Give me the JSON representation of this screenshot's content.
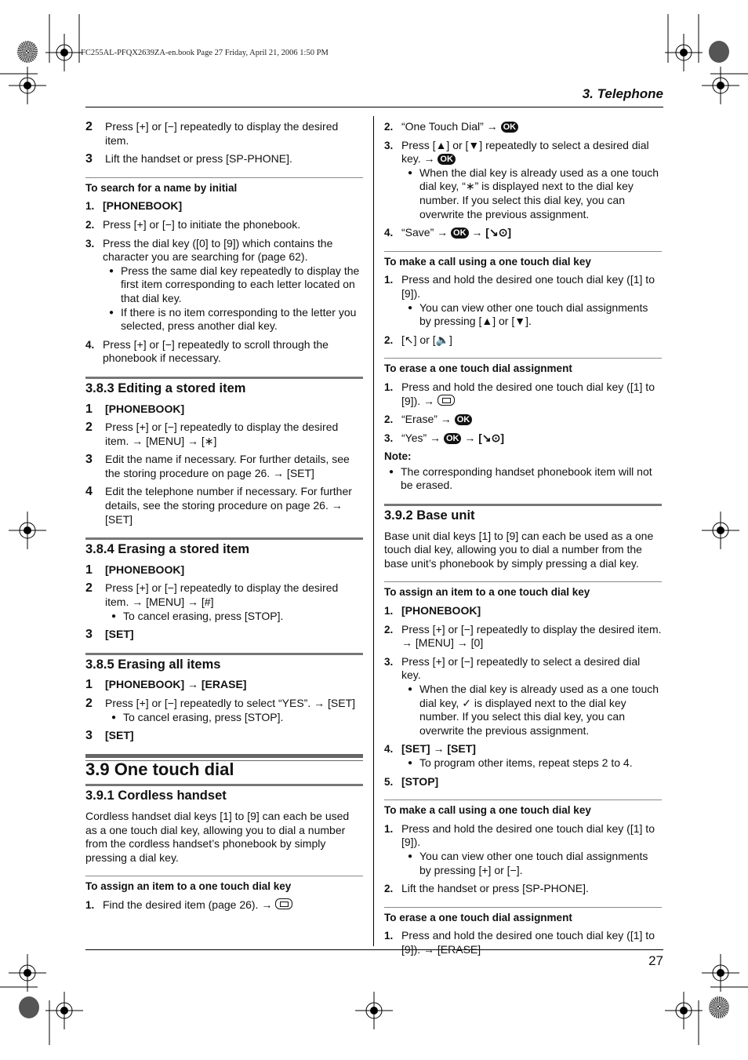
{
  "header": {
    "book_info": "FC255AL-PFQX2639ZA-en.book  Page 27  Friday, April 21, 2006  1:50 PM",
    "chapter": "3. Telephone",
    "page_number": "27"
  },
  "left": {
    "intro_steps": [
      {
        "n": "2",
        "text": "Press [+] or [−] repeatedly to display the desired item."
      },
      {
        "n": "3",
        "text": "Lift the handset or press [SP-PHONE]."
      }
    ],
    "search_initial": {
      "title": "To search for a name by initial",
      "steps": [
        {
          "n": "1.",
          "text": "[PHONEBOOK]"
        },
        {
          "n": "2.",
          "text": "Press [+] or [−] to initiate the phonebook."
        },
        {
          "n": "3.",
          "text": "Press the dial key ([0] to [9]) which contains the character you are searching for (page 62).",
          "bullets": [
            "Press the same dial key repeatedly to display the first item corresponding to each letter located on that dial key.",
            "If there is no item corresponding to the letter you selected, press another dial key."
          ]
        },
        {
          "n": "4.",
          "text": "Press [+] or [−] repeatedly to scroll through the phonebook if necessary."
        }
      ]
    },
    "editing": {
      "title": "3.8.3 Editing a stored item",
      "steps": [
        {
          "n": "1",
          "text": "[PHONEBOOK]"
        },
        {
          "n": "2",
          "text": "Press [+] or [−] repeatedly to display the desired item. → [MENU] → [∗]"
        },
        {
          "n": "3",
          "text": "Edit the name if necessary. For further details, see the storing procedure on page 26. → [SET]"
        },
        {
          "n": "4",
          "text": "Edit the telephone number if necessary. For further details, see the storing procedure on page 26. → [SET]"
        }
      ]
    },
    "erasing": {
      "title": "3.8.4 Erasing a stored item",
      "steps": [
        {
          "n": "1",
          "text": "[PHONEBOOK]"
        },
        {
          "n": "2",
          "text": "Press [+] or [−] repeatedly to display the desired item. → [MENU] → [#]",
          "bullets": [
            "To cancel erasing, press [STOP]."
          ]
        },
        {
          "n": "3",
          "text": "[SET]"
        }
      ]
    },
    "erasing_all": {
      "title": "3.8.5 Erasing all items",
      "steps": [
        {
          "n": "1",
          "text": "[PHONEBOOK] → [ERASE]"
        },
        {
          "n": "2",
          "text": "Press [+] or [−] repeatedly to select “YES”. → [SET]",
          "bullets": [
            "To cancel erasing, press [STOP]."
          ]
        },
        {
          "n": "3",
          "text": "[SET]"
        }
      ]
    },
    "one_touch": {
      "title": "3.9 One touch dial",
      "cordless_title": "3.9.1 Cordless handset",
      "cordless_para": "Cordless handset dial keys [1] to [9] can each be used as a one touch dial key, allowing you to dial a number from the cordless handset’s phonebook by simply pressing a dial key.",
      "assign_title": "To assign an item to a one touch dial key",
      "assign_step1": {
        "n": "1.",
        "text": "Find the desired item (page 26). →"
      }
    }
  },
  "right": {
    "assign_cont": [
      {
        "n": "2.",
        "text": "“One Touch Dial” →"
      },
      {
        "n": "3.",
        "text": "Press [▲] or [▼] repeatedly to select a desired dial key. →",
        "bullets": [
          "When the dial key is already used as a one touch dial key, “∗” is displayed next to the dial key number. If you select this dial key, you can overwrite the previous assignment."
        ]
      },
      {
        "n": "4.",
        "text": "“Save” →",
        "tail": "→ [↘⊙]"
      }
    ],
    "make_call_handset": {
      "title": "To make a call using a one touch dial key",
      "steps": [
        {
          "n": "1.",
          "text": "Press and hold the desired one touch dial key ([1] to [9]).",
          "bullets": [
            "You can view other one touch dial assignments by pressing [▲] or [▼]."
          ]
        },
        {
          "n": "2.",
          "text": "[↖] or [🔈]"
        }
      ]
    },
    "erase_handset": {
      "title": "To erase a one touch dial assignment",
      "steps": [
        {
          "n": "1.",
          "text": "Press and hold the desired one touch dial key ([1] to [9]). →"
        },
        {
          "n": "2.",
          "text": "“Erase” →"
        },
        {
          "n": "3.",
          "text": "“Yes” →",
          "tail": "→ [↘⊙]"
        }
      ],
      "note_label": "Note:",
      "note": "The corresponding handset phonebook item will not be erased."
    },
    "base_unit": {
      "title": "3.9.2 Base unit",
      "para": "Base unit dial keys [1] to [9] can each be used as a one touch dial key, allowing you to dial a number from the base unit’s phonebook by simply pressing a dial key."
    },
    "assign_base": {
      "title": "To assign an item to a one touch dial key",
      "steps": [
        {
          "n": "1.",
          "text": "[PHONEBOOK]"
        },
        {
          "n": "2.",
          "text": "Press [+] or [−] repeatedly to display the desired item. → [MENU] → [0]"
        },
        {
          "n": "3.",
          "text": "Press [+] or [−] repeatedly to select a desired dial key.",
          "bullets": [
            "When the dial key is already used as a one touch dial key, ✓ is displayed next to the dial key number. If you select this dial key, you can overwrite the previous assignment."
          ]
        },
        {
          "n": "4.",
          "text": "[SET] → [SET]",
          "bullets": [
            "To program other items, repeat steps 2 to 4."
          ]
        },
        {
          "n": "5.",
          "text": "[STOP]"
        }
      ]
    },
    "make_call_base": {
      "title": "To make a call using a one touch dial key",
      "steps": [
        {
          "n": "1.",
          "text": "Press and hold the desired one touch dial key ([1] to [9]).",
          "bullets": [
            "You can view other one touch dial assignments by pressing [+] or [−]."
          ]
        },
        {
          "n": "2.",
          "text": "Lift the handset or press [SP-PHONE]."
        }
      ]
    },
    "erase_base": {
      "title": "To erase a one touch dial assignment",
      "steps": [
        {
          "n": "1.",
          "text": "Press and hold the desired one touch dial key ([1] to [9]). → [ERASE]"
        }
      ]
    }
  },
  "icons": {
    "ok_label": "OK"
  }
}
